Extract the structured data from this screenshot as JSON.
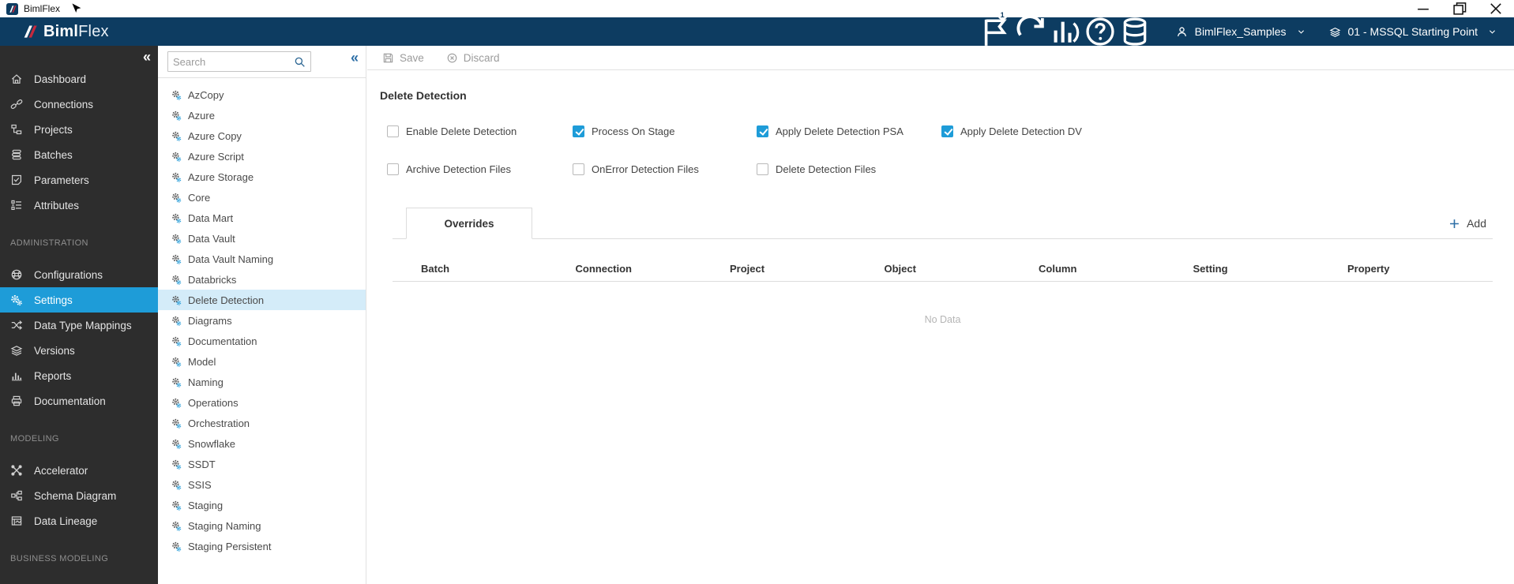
{
  "window": {
    "title": "BimlFlex"
  },
  "app_header": {
    "logo_bold": "Biml",
    "logo_light": "Flex",
    "notification_badge": "1",
    "account_label": "BimlFlex_Samples",
    "environment_label": "01 - MSSQL Starting Point"
  },
  "sidebar": {
    "groups": [
      {
        "header": null,
        "items": [
          {
            "label": "Dashboard",
            "icon": "home"
          },
          {
            "label": "Connections",
            "icon": "link"
          },
          {
            "label": "Projects",
            "icon": "projects"
          },
          {
            "label": "Batches",
            "icon": "batches"
          },
          {
            "label": "Parameters",
            "icon": "parameters"
          },
          {
            "label": "Attributes",
            "icon": "attributes"
          }
        ]
      },
      {
        "header": "ADMINISTRATION",
        "items": [
          {
            "label": "Configurations",
            "icon": "globe"
          },
          {
            "label": "Settings",
            "icon": "gears",
            "active": true
          },
          {
            "label": "Data Type Mappings",
            "icon": "shuffle"
          },
          {
            "label": "Versions",
            "icon": "layers"
          },
          {
            "label": "Reports",
            "icon": "bar-chart"
          },
          {
            "label": "Documentation",
            "icon": "printer"
          }
        ]
      },
      {
        "header": "MODELING",
        "items": [
          {
            "label": "Accelerator",
            "icon": "accelerator"
          },
          {
            "label": "Schema Diagram",
            "icon": "schema-diagram"
          },
          {
            "label": "Data Lineage",
            "icon": "data-lineage"
          }
        ]
      },
      {
        "header": "BUSINESS MODELING",
        "items": []
      }
    ]
  },
  "settings_panel": {
    "search_placeholder": "Search",
    "selected_item": "Delete Detection",
    "items": [
      "AzCopy",
      "Azure",
      "Azure Copy",
      "Azure Script",
      "Azure Storage",
      "Core",
      "Data Mart",
      "Data Vault",
      "Data Vault Naming",
      "Databricks",
      "Delete Detection",
      "Diagrams",
      "Documentation",
      "Model",
      "Naming",
      "Operations",
      "Orchestration",
      "Snowflake",
      "SSDT",
      "SSIS",
      "Staging",
      "Staging Naming",
      "Staging Persistent"
    ]
  },
  "toolbar": {
    "save_label": "Save",
    "discard_label": "Discard"
  },
  "content": {
    "title": "Delete Detection",
    "checkbox_rows": [
      [
        {
          "label": "Enable Delete Detection",
          "checked": false
        },
        {
          "label": "Process On Stage",
          "checked": true
        },
        {
          "label": "Apply Delete Detection PSA",
          "checked": true
        },
        {
          "label": "Apply Delete Detection DV",
          "checked": true
        }
      ],
      [
        {
          "label": "Archive Detection Files",
          "checked": false
        },
        {
          "label": "OnError Detection Files",
          "checked": false
        },
        {
          "label": "Delete Detection Files",
          "checked": false
        }
      ]
    ],
    "tab_label": "Overrides",
    "add_label": "Add",
    "table_headers": [
      "Batch",
      "Connection",
      "Project",
      "Object",
      "Column",
      "Setting",
      "Property"
    ],
    "empty_message": "No Data"
  },
  "colors": {
    "accent_blue": "#1e9cd8",
    "header_navy": "#0d3c61",
    "selection_light": "#d4ecf9",
    "brand_red": "#c5293d"
  }
}
